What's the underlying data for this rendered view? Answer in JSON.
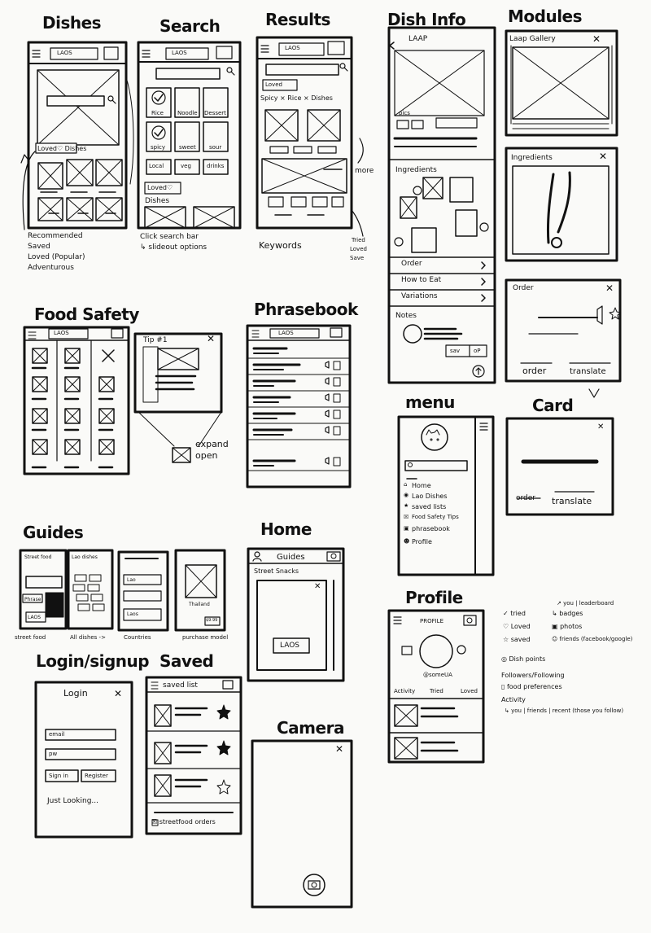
{
  "titles": {
    "dishes": "Dishes",
    "search": "Search",
    "results": "Results",
    "dish_info": "Dish Info",
    "modules": "Modules",
    "food_safety": "Food Safety",
    "phrasebook": "Phrasebook",
    "menu": "menu",
    "card": "Card",
    "guides": "Guides",
    "home": "Home",
    "login_signup": "Login/signup",
    "saved": "Saved",
    "profile": "Profile",
    "camera": "Camera"
  },
  "dishes_screen": {
    "country_select": "LAOS",
    "loved_dishes": "Loved♡ Dishes"
  },
  "dishes_notes": [
    "Recommended",
    "Saved",
    "Loved (Popular)",
    "Adventurous"
  ],
  "search_screen": {
    "country_select": "LAOS",
    "tiles": [
      "Rice",
      "Noodle",
      "Dessert",
      "spicy",
      "sweet",
      "sour",
      "Local",
      "veg",
      "drinks"
    ],
    "loved": "Loved♡",
    "dishes": "Dishes"
  },
  "search_notes": [
    "Click search bar",
    "↳ slideout options"
  ],
  "results_screen": {
    "country_select": "LAOS",
    "loved_filter": "Loved",
    "keywords": "Spicy × Rice × Dishes"
  },
  "results_notes": {
    "more": "more",
    "keywords": "Keywords",
    "tried_loved_save": [
      "Tried",
      "Loved",
      "Save"
    ]
  },
  "dish_info_screen": {
    "title": "LAAP",
    "pics": "pics",
    "ingredients": "Ingredients",
    "rows": [
      "Order",
      "How to Eat",
      "Variations"
    ],
    "notes": "Notes",
    "save": "sav",
    "op": "oP"
  },
  "modules_screens": {
    "gallery": "Laap Gallery",
    "ingredients": "Ingredients",
    "order": "Order",
    "order_btn": "order",
    "translate_btn": "translate"
  },
  "food_safety_screen": {
    "country_select": "LAOS",
    "tip": "Tip #1",
    "note": [
      "expand",
      "open"
    ]
  },
  "phrasebook_screen": {
    "country_select": "LAOS"
  },
  "menu_screen": {
    "items": [
      "Home",
      "Lao Dishes",
      "saved lists",
      "Food Safety Tips",
      "phrasebook",
      "Profile"
    ]
  },
  "card_screen": {
    "order": "order",
    "translate": "translate"
  },
  "guides_screens": {
    "items": [
      {
        "header": "Street food",
        "caption": "street food",
        "box1": "Phrase",
        "box2": "LAOS"
      },
      {
        "header": "Lao dishes",
        "caption": "All dishes ->",
        "box1": "",
        "box2": ""
      },
      {
        "header": "",
        "caption": "Countries",
        "box1": "Lao",
        "box2": "Laos"
      },
      {
        "header": "",
        "caption": "purchase model",
        "box1": "Thailand",
        "box2": "$9.99"
      }
    ]
  },
  "home_screen": {
    "title": "Guides",
    "section": "Street Snacks",
    "card": "LAOS"
  },
  "login_screen": {
    "title": "Login",
    "email": "email",
    "pw": "pw",
    "signin": "Sign in",
    "register": "Register",
    "just_looking": "Just Looking..."
  },
  "saved_screen": {
    "title": "saved list",
    "footer": "☒ streetfood orders"
  },
  "profile_screen": {
    "title": "PROFILE",
    "username": "@someUA",
    "tabs": [
      "Activity",
      "Tried",
      "Loved"
    ]
  },
  "profile_notes": [
    "✓ tried",
    "♡ Loved",
    "☆ saved",
    "↳ badges",
    "▣ photos",
    "☺ friends (facebook/google)",
    "↗ you | leaderboard",
    "◎ Dish points",
    "Followers/Following",
    "▯ food preferences",
    "Activity",
    "↳ you | friends | recent (those you follow)"
  ]
}
